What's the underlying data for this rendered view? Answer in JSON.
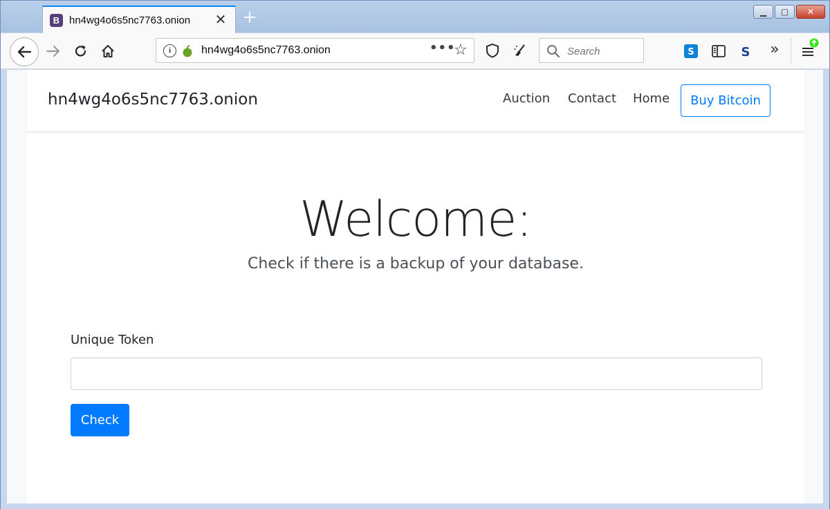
{
  "browser": {
    "tab": {
      "favicon_letter": "B",
      "title": "hn4wg4o6s5nc7763.onion",
      "close": "✕"
    },
    "new_tab": "+",
    "window_controls": {
      "minimize": "▁",
      "maximize": "▢",
      "close": "✕"
    },
    "url": "hn4wg4o6s5nc7763.onion",
    "url_more": "•••",
    "search_placeholder": "Search",
    "colors": {
      "accent": "#0a84ff",
      "onion_green": "#6aa327"
    }
  },
  "site": {
    "brand": "hn4wg4o6s5nc7763.onion",
    "nav": [
      {
        "label": "Auction"
      },
      {
        "label": "Contact"
      },
      {
        "label": "Home"
      }
    ],
    "buy_button": "Buy Bitcoin",
    "hero": {
      "title": "Welcome:",
      "subtitle": "Check if there is a backup of your database."
    },
    "form": {
      "label": "Unique Token",
      "value": "",
      "submit": "Check"
    },
    "colors": {
      "primary": "#007bff",
      "text": "#212529"
    }
  }
}
